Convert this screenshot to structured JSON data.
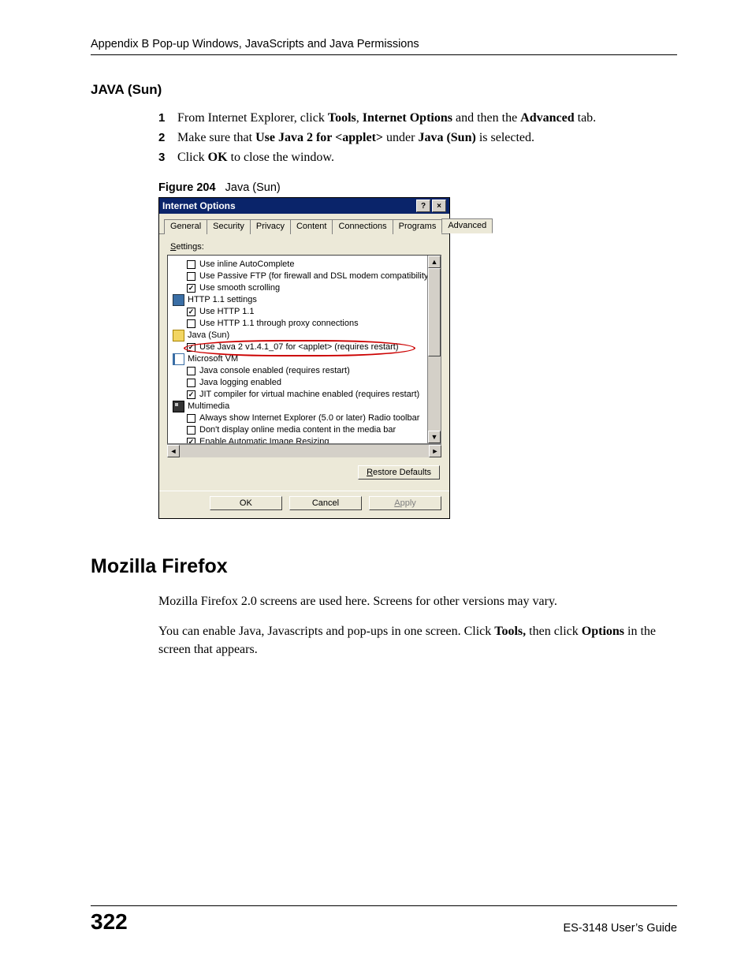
{
  "header": {
    "running": "Appendix B Pop-up Windows, JavaScripts and Java Permissions"
  },
  "section_java": {
    "title": "JAVA (Sun)",
    "steps": [
      {
        "n": "1",
        "pre": "From Internet Explorer, click ",
        "b1": "Tools",
        "mid1": ", ",
        "b2": "Internet Options",
        "mid2": " and then the ",
        "b3": "Advanced",
        "post": " tab."
      },
      {
        "n": "2",
        "pre": "Make sure that ",
        "b1": "Use Java 2 for <applet>",
        "mid1": " under ",
        "b2": "Java (Sun)",
        "post": " is selected."
      },
      {
        "n": "3",
        "pre": "Click ",
        "b1": "OK",
        "post": " to close the window."
      }
    ],
    "figure": {
      "label": "Figure 204",
      "caption": "Java (Sun)"
    }
  },
  "dialog": {
    "title": "Internet Options",
    "help_glyph": "?",
    "close_glyph": "×",
    "tabs": [
      "General",
      "Security",
      "Privacy",
      "Content",
      "Connections",
      "Programs",
      "Advanced"
    ],
    "active_tab": "Advanced",
    "settings_label_pre": "S",
    "settings_label_post": "ettings:",
    "tree": [
      {
        "level": 1,
        "type": "check",
        "checked": false,
        "label": "Use inline AutoComplete"
      },
      {
        "level": 1,
        "type": "check",
        "checked": false,
        "label": "Use Passive FTP (for firewall and DSL modem compatibility)"
      },
      {
        "level": 1,
        "type": "check",
        "checked": true,
        "label": "Use smooth scrolling"
      },
      {
        "level": 0,
        "type": "cat",
        "icon": "ic-blue",
        "label": "HTTP 1.1 settings"
      },
      {
        "level": 1,
        "type": "check",
        "checked": true,
        "label": "Use HTTP 1.1"
      },
      {
        "level": 1,
        "type": "check",
        "checked": false,
        "label": "Use HTTP 1.1 through proxy connections"
      },
      {
        "level": 0,
        "type": "cat",
        "icon": "ic-yel",
        "label": "Java (Sun)"
      },
      {
        "level": 1,
        "type": "check",
        "checked": true,
        "label": "Use Java 2 v1.4.1_07 for <applet> (requires restart)",
        "highlight": true
      },
      {
        "level": 0,
        "type": "cat",
        "icon": "ic-doc",
        "label": "Microsoft VM"
      },
      {
        "level": 1,
        "type": "check",
        "checked": false,
        "label": "Java console enabled (requires restart)"
      },
      {
        "level": 1,
        "type": "check",
        "checked": false,
        "label": "Java logging enabled"
      },
      {
        "level": 1,
        "type": "check",
        "checked": true,
        "label": "JIT compiler for virtual machine enabled (requires restart)"
      },
      {
        "level": 0,
        "type": "cat",
        "icon": "ic-mm",
        "label": "Multimedia"
      },
      {
        "level": 1,
        "type": "check",
        "checked": false,
        "label": "Always show Internet Explorer (5.0 or later) Radio toolbar"
      },
      {
        "level": 1,
        "type": "check",
        "checked": false,
        "label": "Don't display online media content in the media bar"
      },
      {
        "level": 1,
        "type": "check",
        "checked": true,
        "label": "Enable Automatic Image Resizing"
      }
    ],
    "restore_btn": "Restore Defaults",
    "buttons": {
      "ok": "OK",
      "cancel": "Cancel",
      "apply": "Apply"
    },
    "scroll": {
      "up": "▲",
      "down": "▼",
      "left": "◄",
      "right": "►"
    }
  },
  "section_firefox": {
    "title": "Mozilla Firefox",
    "p1": "Mozilla Firefox 2.0 screens are used here. Screens for other versions may vary.",
    "p2_pre": "You can enable Java, Javascripts and pop-ups in one screen. Click ",
    "p2_b1": "Tools,",
    "p2_mid": " then click ",
    "p2_b2": "Options",
    "p2_post": " in the screen that appears."
  },
  "footer": {
    "page": "322",
    "guide": "ES-3148 User’s Guide"
  }
}
